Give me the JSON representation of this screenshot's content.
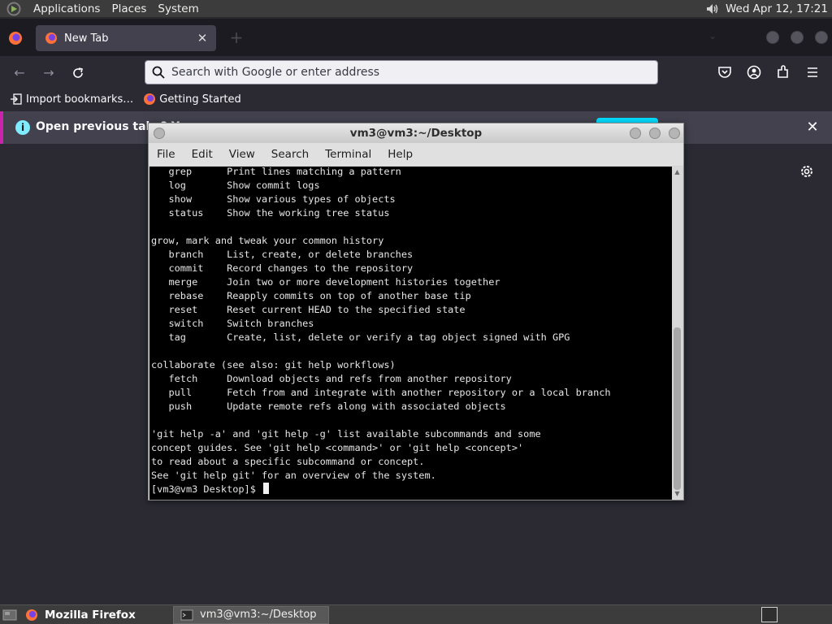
{
  "top_panel": {
    "menus": [
      "Applications",
      "Places",
      "System"
    ],
    "clock": "Wed Apr 12, 17:21"
  },
  "browser": {
    "tab": {
      "title": "New Tab"
    },
    "urlbar": {
      "placeholder": "Search with Google or enter address"
    },
    "bookmarks": [
      {
        "label": "Import bookmarks…",
        "icon": "import-icon"
      },
      {
        "label": "Getting Started",
        "icon": "firefox-icon"
      }
    ],
    "notification": {
      "text": "Open previous tabs? Y"
    }
  },
  "terminal": {
    "title": "vm3@vm3:~/Desktop",
    "menus": [
      "File",
      "Edit",
      "View",
      "Search",
      "Terminal",
      "Help"
    ],
    "lines": [
      "   grep      Print lines matching a pattern",
      "   log       Show commit logs",
      "   show      Show various types of objects",
      "   status    Show the working tree status",
      "",
      "grow, mark and tweak your common history",
      "   branch    List, create, or delete branches",
      "   commit    Record changes to the repository",
      "   merge     Join two or more development histories together",
      "   rebase    Reapply commits on top of another base tip",
      "   reset     Reset current HEAD to the specified state",
      "   switch    Switch branches",
      "   tag       Create, list, delete or verify a tag object signed with GPG",
      "",
      "collaborate (see also: git help workflows)",
      "   fetch     Download objects and refs from another repository",
      "   pull      Fetch from and integrate with another repository or a local branch",
      "   push      Update remote refs along with associated objects",
      "",
      "'git help -a' and 'git help -g' list available subcommands and some",
      "concept guides. See 'git help <command>' or 'git help <concept>'",
      "to read about a specific subcommand or concept.",
      "See 'git help git' for an overview of the system."
    ],
    "prompt": "[vm3@vm3 Desktop]$ "
  },
  "taskbar": {
    "tasks": [
      "Mozilla Firefox",
      "vm3@vm3:~/Desktop"
    ]
  },
  "colors": {
    "panel": "#3c3c3c",
    "browser_bg": "#2b2a33",
    "tab_active": "#42414d",
    "accent_cyan": "#00ddff",
    "notif_border": "#ca24ac",
    "terminal_bg": "#000000"
  }
}
